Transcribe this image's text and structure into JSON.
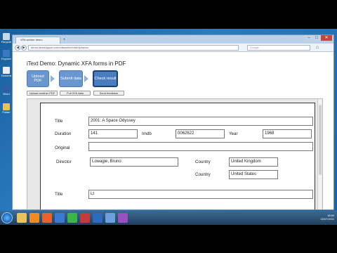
{
  "desktop": {
    "icons": [
      {
        "label": "Recycle Bin",
        "color": "#c9d8e8"
      },
      {
        "label": "Explorer",
        "color": "#3a78c2"
      },
      {
        "label": "Document",
        "color": "#e9eef5"
      },
      {
        "label": "Word",
        "color": "#2f5ea8"
      },
      {
        "label": "Folder",
        "color": "#e8c35a"
      }
    ]
  },
  "browser": {
    "tab_title": "XFA worker demo",
    "url": "demo.itextsupport.com/xfaworker/xfa/dynamic/",
    "search_placeholder": "Google",
    "win_min": "–",
    "win_max": "□",
    "win_close": "✕",
    "new_tab": "+",
    "back": "◀",
    "forward": "▶",
    "home_icon": "⌂"
  },
  "page": {
    "title": "iText Demo: Dynamic XFA forms in PDF",
    "steps": [
      "Upload PDF",
      "Submit data",
      "Check result"
    ],
    "buttons": {
      "upload_another": "Upload another PDF",
      "full_xfa": "Full XFA data",
      "feedback": "Send feedback"
    }
  },
  "form": {
    "title_label": "Title",
    "title_value": "2001: A Space Odyssey",
    "duration_label": "Duration",
    "duration_value": "141",
    "imdb_label": "Imdb",
    "imdb_value": "0062622",
    "year_label": "Year",
    "year_value": "1968",
    "original_label": "Original",
    "original_value": "",
    "director_label": "Director",
    "director_value": "Lowagie, Bruno",
    "country_label_1": "Country",
    "country_value_1": "United Kingdom",
    "country_label_2": "Country",
    "country_value_2": "United States",
    "partial_label": "Title",
    "partial_value": "Lt"
  },
  "taskbar": {
    "items": [
      {
        "name": "explorer",
        "color": "#e8c35a"
      },
      {
        "name": "media",
        "color": "#f08a24"
      },
      {
        "name": "firefox",
        "color": "#e8632c"
      },
      {
        "name": "app4",
        "color": "#3a7ad0"
      },
      {
        "name": "app5",
        "color": "#3bb54a"
      },
      {
        "name": "app6",
        "color": "#c43a3a"
      },
      {
        "name": "app7",
        "color": "#2c6bbd"
      },
      {
        "name": "app8",
        "color": "#6ca0dc"
      },
      {
        "name": "app9",
        "color": "#9a4fc0"
      }
    ],
    "time": "18:50",
    "date": "15/07/2011"
  }
}
